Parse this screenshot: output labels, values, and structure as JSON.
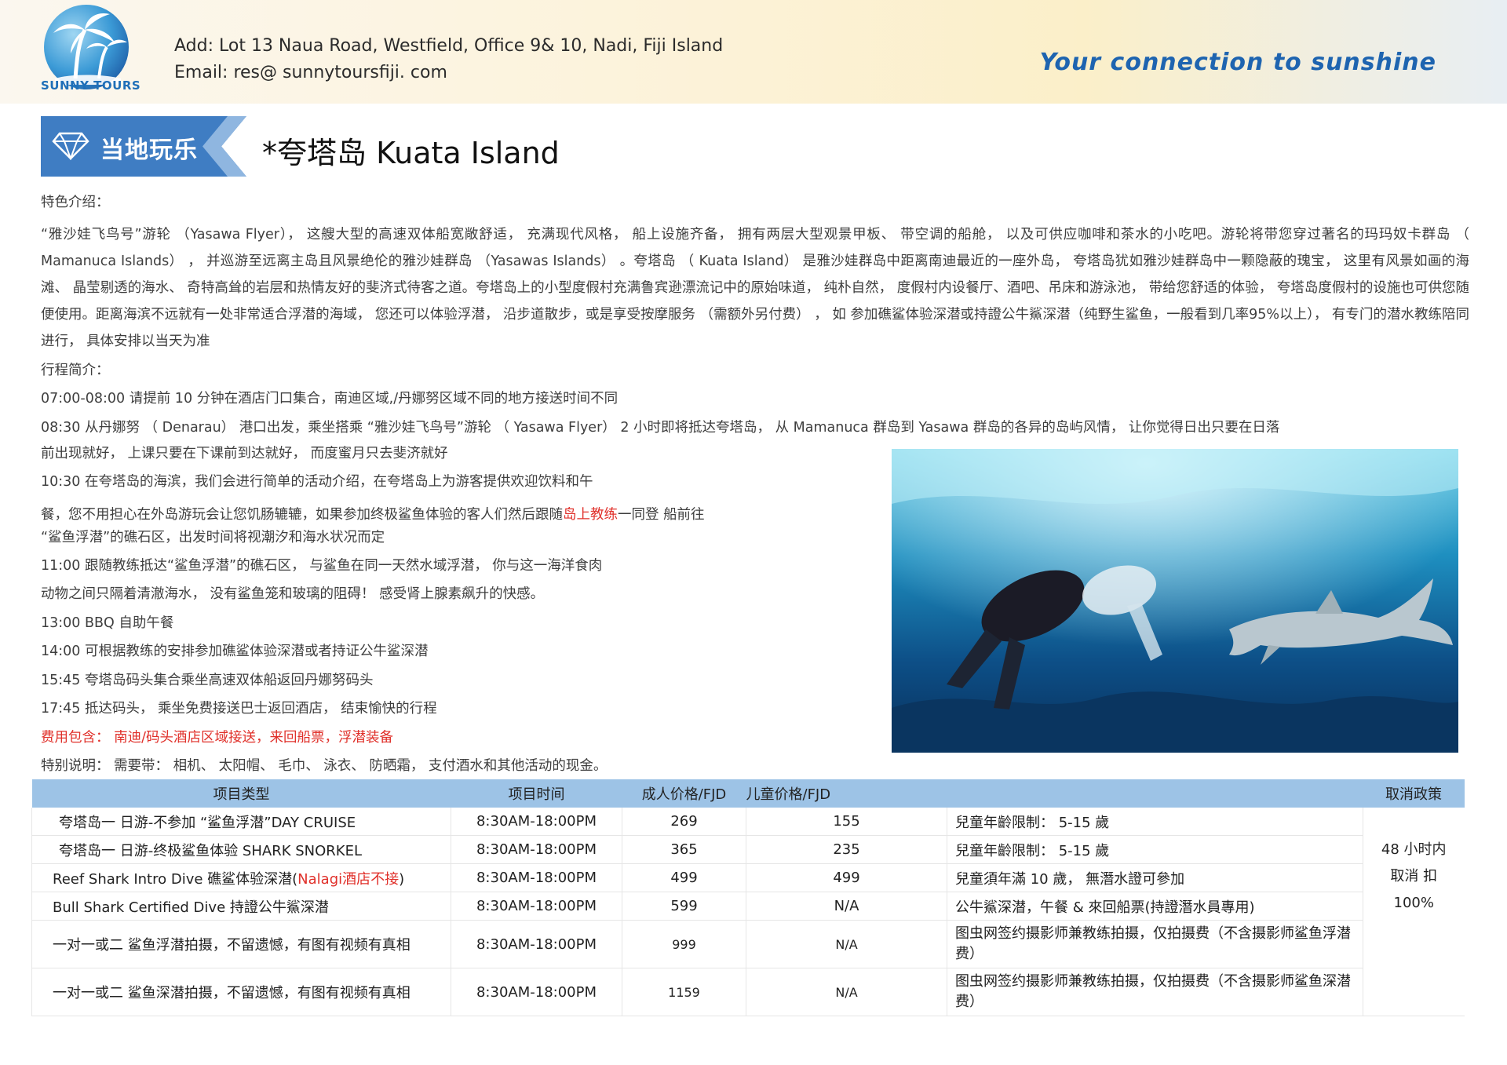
{
  "header": {
    "logo_text": "SUNNY TOURS",
    "address": "Add:  Lot 13  Naua  Road,  Westfield,  Office  9& 10,  Nadi,  Fiji Island",
    "email": "Email:   res@ sunnytoursfiji. com",
    "slogan": "Your  connection  to  sunshine"
  },
  "badge": {
    "label": "当地玩乐",
    "icon": "diamond-icon"
  },
  "title": "*夸塔岛  Kuata Island",
  "intro": {
    "heading": "特色介绍：",
    "body": "“雅沙娃飞鸟号”游轮 （Yasawa Flyer）， 这艘大型的高速双体船宽敞舒适， 充满现代风格， 船上设施齐备， 拥有两层大型观景甲板、 带空调的船舱， 以及可供应咖啡和茶水的小吃吧。游轮将带您穿过著名的玛玛奴卡群岛 （ Mamanuca Islands） ， 并巡游至远离主岛且风景绝伦的雅沙娃群岛 （Yasawas Islands） 。夸塔岛 （ Kuata Island） 是雅沙娃群岛中距离南迪最近的一座外岛， 夸塔岛犹如雅沙娃群岛中一颗隐蔽的瑰宝， 这里有风景如画的海滩、 晶莹剔透的海水、 奇特高耸的岩层和热情友好的斐济式待客之道。夸塔岛上的小型度假村充满鲁宾逊漂流记中的原始味道， 纯朴自然， 度假村内设餐厅、酒吧、吊床和游泳池， 带给您舒适的体验， 夸塔岛度假村的设施也可供您随便使用。距离海滨不远就有一处非常适合浮潜的海域， 您还可以体验浮潜， 沿步道散步，或是享受按摩服务 （需额外另付费） ， 如 参加礁鲨体验深潜或持證公牛鯊深潜（纯野生鲨鱼，一般看到几率95%以上）， 有专门的潜水教练陪同进行， 具体安排以当天为准"
  },
  "itinerary": {
    "heading": "行程简介：",
    "l1": "07:00-08:00   请提前 10 分钟在酒店门口集合，南迪区域,/丹娜努区域不同的地方接送时间不同",
    "l2a": "08:30     从丹娜努 （ Denarau） 港口出发，乘坐搭乘  “雅沙娃飞鸟号”游轮 （ Yasawa Flyer） 2 小时即将抵达夸塔岛， 从 Mamanuca 群岛到 Yasawa 群岛的各异的岛屿风情， 让你觉得日出只要在日落",
    "l2b": "前出现就好， 上课只要在下课前到达就好， 而度蜜月只去斐济就好",
    "l3a": "10:30     在夸塔岛的海滨，我们会进行简单的活动介绍，在夸塔岛上为游客提供欢迎饮料和午",
    "l3b_pre": "餐，您不用担心在外岛游玩会让您饥肠辘辘，如果参加终极鲨鱼体验的客人们然后跟随",
    "l3b_red": "岛上教练",
    "l3b_post": "一同登 船前往",
    "l3c": "“鲨鱼浮潜”的礁石区，出发时间将视潮汐和海水状况而定",
    "l4a": "11:00     跟随教练抵达“鲨鱼浮潜”的礁石区， 与鲨鱼在同一天然水域浮潜， 你与这一海洋食肉",
    "l4b": "动物之间只隔着清澈海水， 没有鲨鱼笼和玻璃的阻碍！ 感受肾上腺素飙升的快感。",
    "l5": "13:00     BBQ 自助午餐",
    "l6": "14:00     可根据教练的安排参加礁鲨体验深潜或者持证公牛鲨深潜",
    "l7": "15:45     夸塔岛码头集合乘坐高速双体船返回丹娜努码头",
    "l8": "17:45     抵达码头， 乘坐免费接送巴士返回酒店， 结束愉快的行程"
  },
  "included": {
    "label": "费用包含：",
    "text": "   南迪/码头酒店区域接送，来回船票，浮潜装备"
  },
  "notes": "特别说明：  需要带：  相机、 太阳帽、  毛巾、  泳衣、  防晒霜，   支付酒水和其他活动的现金。",
  "table": {
    "headers": {
      "type": "项目类型",
      "time": "项目时间",
      "adult": "成人价格/FJD",
      "child": "儿童价格/FJD",
      "note": "",
      "policy": "取消政策"
    },
    "rows": [
      {
        "type": "夸塔岛一 日游-不参加  “鲨鱼浮潜”DAY CRUISE",
        "time": "8:30AM-18:00PM",
        "adult": "269",
        "child": "155",
        "note": "兒童年齡限制：   5-15 歲"
      },
      {
        "type": "夸塔岛一 日游-终极鲨鱼体验 SHARK SNORKEL",
        "time": "8:30AM-18:00PM",
        "adult": "365",
        "child": "235",
        "note": "兒童年齡限制：   5-15 歲"
      },
      {
        "type_pre": "Reef  Shark  Intro  Dive  礁鲨体验深潜(",
        "type_red": "Nalagi酒店不接",
        "type_post": ")",
        "time": "8:30AM-18:00PM",
        "adult": "499",
        "child": "499",
        "note": "兒童須年滿 10 歲，  無潛水證可參加"
      },
      {
        "type": "Bull  Shark  Certified  Dive  持證公牛鯊深潜",
        "time": "8:30AM-18:00PM",
        "adult": "599",
        "child": "N/A",
        "note": "公牛鯊深潜，午餐  & 來回船票(持證潛水員專用)"
      },
      {
        "type": "一对一或二 鲨鱼浮潜拍摄，不留遗憾，有图有视频有真相",
        "time": "8:30AM-18:00PM",
        "adult": "999",
        "child": "N/A",
        "note": "图虫网签约摄影师兼教练拍摄，仅拍摄费（不含摄影师鲨鱼浮潜费）"
      },
      {
        "type": "一对一或二 鲨鱼深潜拍摄，不留遗憾，有图有视频有真相",
        "time": "8:30AM-18:00PM",
        "adult": "1159",
        "child": "N/A",
        "note": "图虫网签约摄影师兼教练拍摄，仅拍摄费（不含摄影师鲨鱼深潜费）"
      }
    ],
    "policy_line1": "48 小时内",
    "policy_line2": "取消  扣",
    "policy_line3": "100%"
  },
  "colors": {
    "accent_blue": "#1e64b0",
    "header_row": "#9dc3e6",
    "red": "#e0302a",
    "badge": "#3f7dc3"
  }
}
